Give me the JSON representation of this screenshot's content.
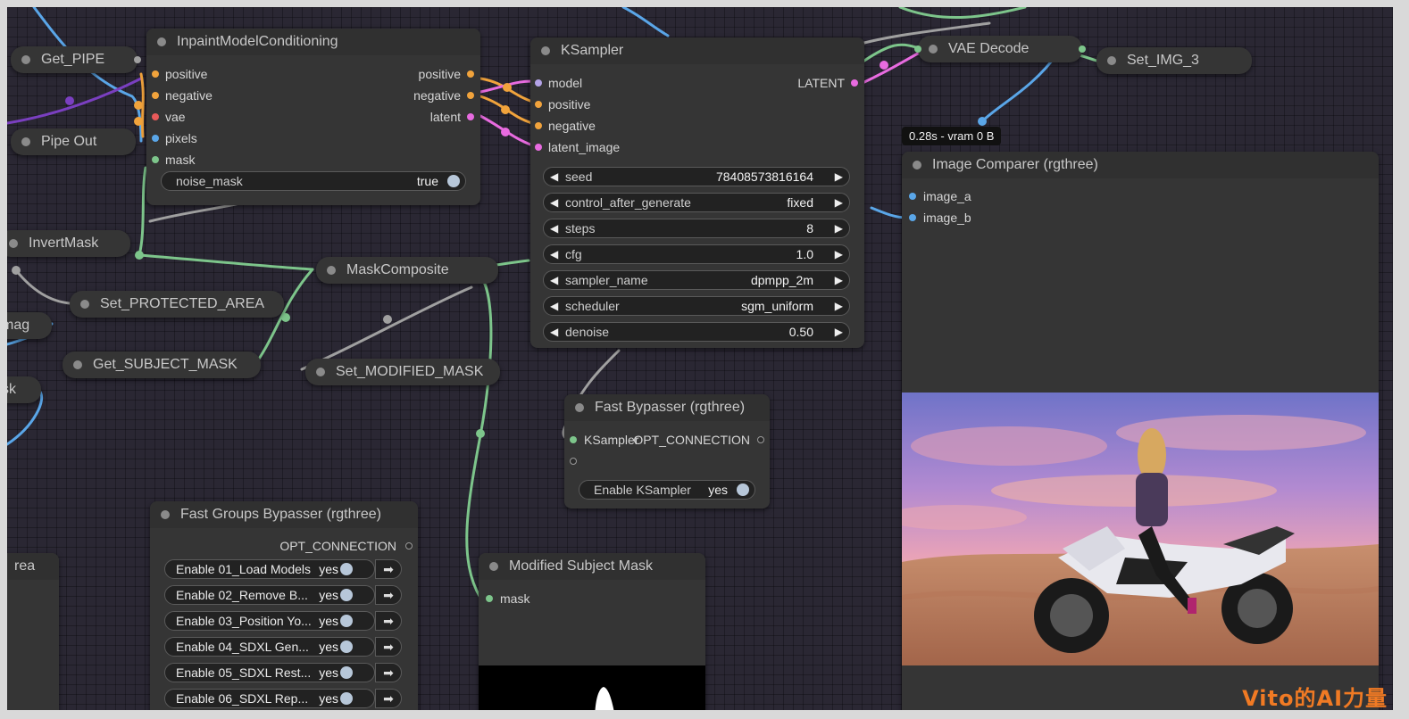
{
  "colors": {
    "canvas": "#2a2733",
    "node": "#353535",
    "title_bar": "#303030",
    "wire_green": "#7dc58b",
    "wire_blue": "#5aa6e8",
    "wire_purple": "#7a3fc0",
    "wire_pink": "#e86be0",
    "wire_orange": "#f1a33c",
    "wire_grey": "#a0a0a0"
  },
  "nodes": {
    "get_pipe": {
      "title": "Get_PIPE"
    },
    "pipe_out": {
      "title": "Pipe Out"
    },
    "invert_mask": {
      "title": "InvertMask"
    },
    "set_protected": {
      "title": "Set_PROTECTED_AREA"
    },
    "left_mag": {
      "title": "mag"
    },
    "get_subject": {
      "title": "Get_SUBJECT_MASK"
    },
    "left_sk": {
      "title": "sk"
    },
    "left_rea": {
      "title": "rea"
    },
    "mask_composite": {
      "title": "MaskComposite"
    },
    "set_modified": {
      "title": "Set_MODIFIED_MASK"
    },
    "inpaint": {
      "title": "InpaintModelConditioning",
      "inputs": [
        "positive",
        "negative",
        "vae",
        "pixels",
        "mask"
      ],
      "outputs": [
        "positive",
        "negative",
        "latent"
      ],
      "noise_mask": {
        "label": "noise_mask",
        "value": "true"
      }
    },
    "ksampler": {
      "title": "KSampler",
      "inputs": [
        "model",
        "positive",
        "negative",
        "latent_image"
      ],
      "output": "LATENT",
      "widgets": [
        {
          "label": "seed",
          "value": "78408573816164"
        },
        {
          "label": "control_after_generate",
          "value": "fixed"
        },
        {
          "label": "steps",
          "value": "8"
        },
        {
          "label": "cfg",
          "value": "1.0"
        },
        {
          "label": "sampler_name",
          "value": "dpmpp_2m"
        },
        {
          "label": "scheduler",
          "value": "sgm_uniform"
        },
        {
          "label": "denoise",
          "value": "0.50"
        }
      ]
    },
    "vae_decode": {
      "title": "VAE Decode"
    },
    "set_img": {
      "title": "Set_IMG_3"
    },
    "timing": {
      "text": "0.28s - vram 0 B"
    },
    "image_comparer": {
      "title": "Image Comparer (rgthree)",
      "inputs": [
        "image_a",
        "image_b"
      ]
    },
    "fast_bypasser": {
      "title": "Fast Bypasser (rgthree)",
      "input": "KSampler",
      "output": "OPT_CONNECTION",
      "toggle": {
        "label": "Enable KSampler",
        "value": "yes"
      }
    },
    "fast_groups": {
      "title": "Fast Groups Bypasser (rgthree)",
      "output": "OPT_CONNECTION",
      "toggles": [
        {
          "label": "Enable 01_Load Models",
          "value": "yes"
        },
        {
          "label": "Enable 02_Remove B...",
          "value": "yes"
        },
        {
          "label": "Enable 03_Position Yo...",
          "value": "yes"
        },
        {
          "label": "Enable 04_SDXL Gen...",
          "value": "yes"
        },
        {
          "label": "Enable 05_SDXL Rest...",
          "value": "yes"
        },
        {
          "label": "Enable 06_SDXL Rep...",
          "value": "yes"
        }
      ]
    },
    "modified_mask": {
      "title": "Modified Subject Mask",
      "input": "mask"
    }
  },
  "watermark": "Vito的AI力量",
  "icons": {
    "arrow_left": "left-arrow-icon",
    "arrow_right": "right-arrow-icon",
    "group_nav": "arrow-right-icon"
  }
}
